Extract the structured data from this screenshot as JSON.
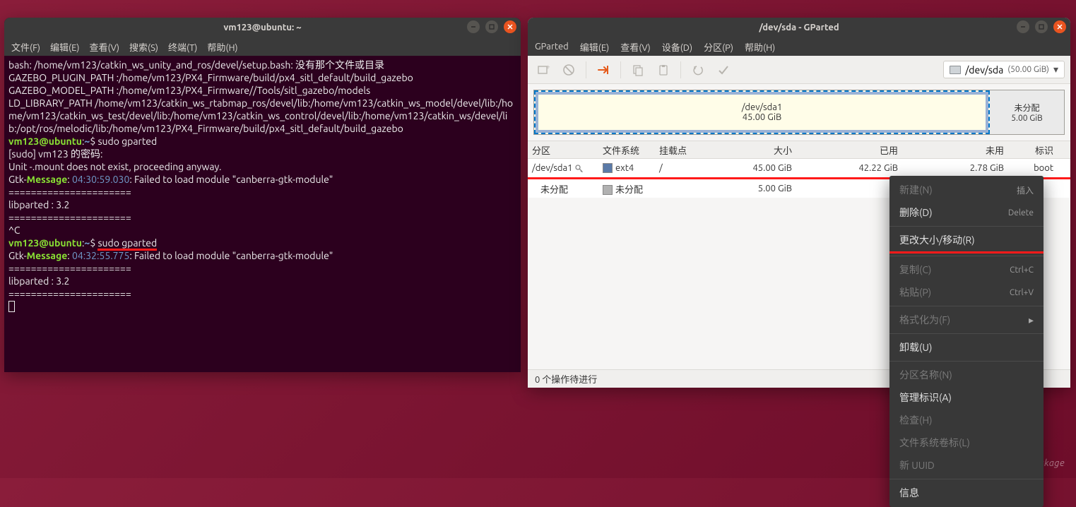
{
  "terminal": {
    "title": "vm123@ubuntu: ~",
    "menu": [
      "文件(F)",
      "编辑(E)",
      "查看(V)",
      "搜索(S)",
      "终端(T)",
      "帮助(H)"
    ],
    "lines": {
      "l1a": "bash: /home/vm123/catkin_ws_unity_and_ros/devel/setup.bash: ",
      "l1b": "没有那个文件或目录",
      "l2": "GAZEBO_PLUGIN_PATH :/home/vm123/PX4_Firmware/build/px4_sitl_default/build_gazebo",
      "l3": "GAZEBO_MODEL_PATH :/home/vm123/PX4_Firmware//Tools/sitl_gazebo/models",
      "l4": "LD_LIBRARY_PATH /home/vm123/catkin_ws_rtabmap_ros/devel/lib:/home/vm123/catkin_ws_model/devel/lib:/home/vm123/catkin_ws_test/devel/lib:/home/vm123/catkin_ws_control/devel/lib:/home/vm123/catkin_ws/devel/lib:/opt/ros/melodic/lib:/home/vm123/PX4_Firmware/build/px4_sitl_default/build_gazebo",
      "prompt_user": "vm123@ubuntu",
      "prompt_sep": ":",
      "prompt_path": "~",
      "prompt_dollar": "$ ",
      "cmd1": "sudo gparted",
      "sudo_pw": "[sudo] vm123 的密码:",
      "unit": "Unit -.mount does not exist, proceeding anyway.",
      "gtk_pre": "Gtk-",
      "gtk_msg": "Message",
      "gtk_sep": ": ",
      "gtk_t1": "04:30:59.030",
      "gtk_post": ": Failed to load module \"canberra-gtk-module\"",
      "dashes": "======================",
      "lib": "libparted : 3.2",
      "ctrlc": "^C",
      "gtk_t2": "04:32:55.775"
    }
  },
  "gparted": {
    "title": "/dev/sda - GParted",
    "menu": [
      "GParted",
      "编辑(E)",
      "查看(V)",
      "设备(D)",
      "分区(P)",
      "帮助(H)"
    ],
    "device": {
      "path": "/dev/sda",
      "size": "(50.00 GiB)"
    },
    "map": {
      "main_label": "/dev/sda1",
      "main_size": "45.00 GiB",
      "un_label": "未分配",
      "un_size": "5.00 GiB"
    },
    "cols": {
      "part": "分区",
      "fs": "文件系统",
      "mnt": "挂载点",
      "size": "大小",
      "used": "已用",
      "free": "未用",
      "flag": "标识"
    },
    "rows": [
      {
        "part": "/dev/sda1",
        "fs": "ext4",
        "mnt": "/",
        "size": "45.00 GiB",
        "used": "42.22 GiB",
        "free": "2.78 GiB",
        "flag": "boot",
        "hasKey": true,
        "swatch": "fs-ext4"
      },
      {
        "part": "未分配",
        "fs": "未分配",
        "mnt": "",
        "size": "5.00 GiB",
        "used": "---",
        "free": "---",
        "flag": "",
        "hasKey": false,
        "swatch": "fs-un"
      }
    ],
    "status": "0 个操作待进行"
  },
  "context_menu": {
    "items": [
      {
        "label": "新建(N)",
        "shortcut": "插入",
        "disabled": true
      },
      {
        "label": "删除(D)",
        "shortcut": "Delete",
        "disabled": false
      },
      {
        "sep": true
      },
      {
        "label": "更改大小/移动(R)",
        "shortcut": "",
        "disabled": false,
        "redline_after": true
      },
      {
        "sep": true
      },
      {
        "label": "复制(C)",
        "shortcut": "Ctrl+C",
        "disabled": true
      },
      {
        "label": "粘贴(P)",
        "shortcut": "Ctrl+V",
        "disabled": true
      },
      {
        "sep": true
      },
      {
        "label": "格式化为(F)",
        "shortcut": "",
        "disabled": true,
        "submenu": true
      },
      {
        "sep": true
      },
      {
        "label": "卸载(U)",
        "shortcut": "",
        "disabled": false
      },
      {
        "sep": true
      },
      {
        "label": "分区名称(N)",
        "shortcut": "",
        "disabled": true
      },
      {
        "label": "管理标识(A)",
        "shortcut": "",
        "disabled": false
      },
      {
        "label": "检查(H)",
        "shortcut": "",
        "disabled": true
      },
      {
        "label": "文件系统卷标(L)",
        "shortcut": "",
        "disabled": true
      },
      {
        "label": "新 UUID",
        "shortcut": "",
        "disabled": true
      },
      {
        "sep": true
      },
      {
        "label": "信息",
        "shortcut": "",
        "disabled": false
      }
    ]
  },
  "watermark": "CSDN @H_Jackage"
}
